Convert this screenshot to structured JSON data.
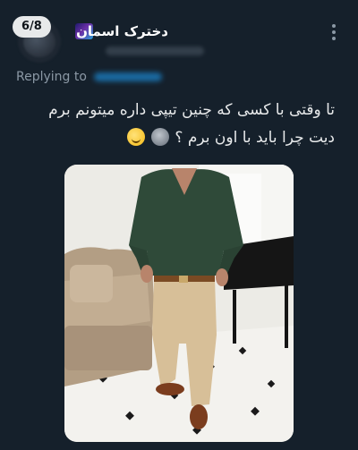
{
  "tweet": {
    "counter": "6/8",
    "display_name": "دخترک اسمان",
    "replying_label": "Replying to",
    "text_line1": "تا وقتی با کسی که چنین تیپی داره میتونم برم",
    "text_line2": "دیت چرا باید با اون برم ؟"
  },
  "icons": {
    "more": "more-vertical-icon",
    "name_badge": "galaxy-emoji-icon",
    "laugh": "grinning-sweat-emoji-icon",
    "moon": "new-moon-face-emoji-icon"
  },
  "colors": {
    "background": "#15202b",
    "text": "#e7e9ea",
    "muted": "#8b98a5",
    "accent": "#1d9bf0"
  },
  "media": {
    "description_alt": ""
  }
}
